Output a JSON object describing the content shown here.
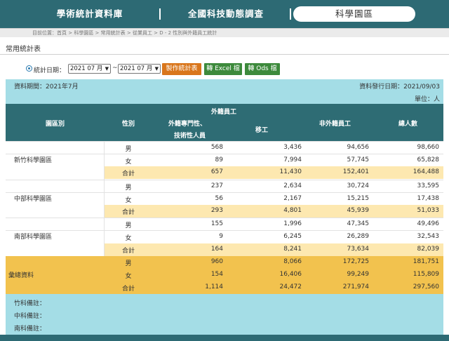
{
  "nav": {
    "items": [
      "學術統計資料庫",
      "全國科技動態調查",
      "科學園區"
    ]
  },
  "breadcrumb": "目前位置：首頁 > 科學園區 > 常用統計表 > 從業員工 > D - 2 性別與外籍員工統計",
  "page_title": "常用統計表",
  "filter": {
    "label": "統計日期：",
    "from": "2021 07 月",
    "to": "2021 07 月",
    "separator": "~",
    "make_button": "製作統計表",
    "excel_button": "轉 Excel 檔",
    "ods_button": "轉 Ods 檔"
  },
  "info": {
    "period": "資料期間：2021年7月",
    "publish": "資料發行日期：2021/09/03",
    "unit": "單位：人"
  },
  "table": {
    "headers": {
      "park": "園區別",
      "gender": "性別",
      "foreign_group": "外籍員工",
      "foreign_pro_1": "外籍專門性、",
      "foreign_pro_2": "技術性人員",
      "migrant": "移工",
      "non_foreign": "非外籍員工",
      "total": "總人數"
    },
    "groups": [
      {
        "name": "新竹科學園區",
        "rows": [
          {
            "gender": "男",
            "pro": "568",
            "migrant": "3,436",
            "non_foreign": "94,656",
            "total": "98,660"
          },
          {
            "gender": "女",
            "pro": "89",
            "migrant": "7,994",
            "non_foreign": "57,745",
            "total": "65,828"
          },
          {
            "gender": "合計",
            "pro": "657",
            "migrant": "11,430",
            "non_foreign": "152,401",
            "total": "164,488"
          }
        ]
      },
      {
        "name": "中部科學園區",
        "rows": [
          {
            "gender": "男",
            "pro": "237",
            "migrant": "2,634",
            "non_foreign": "30,724",
            "total": "33,595"
          },
          {
            "gender": "女",
            "pro": "56",
            "migrant": "2,167",
            "non_foreign": "15,215",
            "total": "17,438"
          },
          {
            "gender": "合計",
            "pro": "293",
            "migrant": "4,801",
            "non_foreign": "45,939",
            "total": "51,033"
          }
        ]
      },
      {
        "name": "南部科學園區",
        "rows": [
          {
            "gender": "男",
            "pro": "155",
            "migrant": "1,996",
            "non_foreign": "47,345",
            "total": "49,496"
          },
          {
            "gender": "女",
            "pro": "9",
            "migrant": "6,245",
            "non_foreign": "26,289",
            "total": "32,543"
          },
          {
            "gender": "合計",
            "pro": "164",
            "migrant": "8,241",
            "non_foreign": "73,634",
            "total": "82,039"
          }
        ]
      },
      {
        "name": "彙總資料",
        "rows": [
          {
            "gender": "男",
            "pro": "960",
            "migrant": "8,066",
            "non_foreign": "172,725",
            "total": "181,751"
          },
          {
            "gender": "女",
            "pro": "154",
            "migrant": "16,406",
            "non_foreign": "99,249",
            "total": "115,809"
          },
          {
            "gender": "合計",
            "pro": "1,114",
            "migrant": "24,472",
            "non_foreign": "271,974",
            "total": "297,560"
          }
        ]
      }
    ]
  },
  "remarks": [
    "竹科備註：",
    "中科備註：",
    "南科備註："
  ],
  "colors": {
    "nav": "#2d6a74",
    "header": "#2e6c74",
    "info_band": "#a4dde6",
    "subtotal": "#fde8b0",
    "summary": "#f2c24e",
    "orange_button": "#d9761c",
    "green_button": "#3d8a3c"
  },
  "icons": {
    "filter_bullet": "radio-dot-icon",
    "select_chevron": "chevron-down-icon"
  }
}
